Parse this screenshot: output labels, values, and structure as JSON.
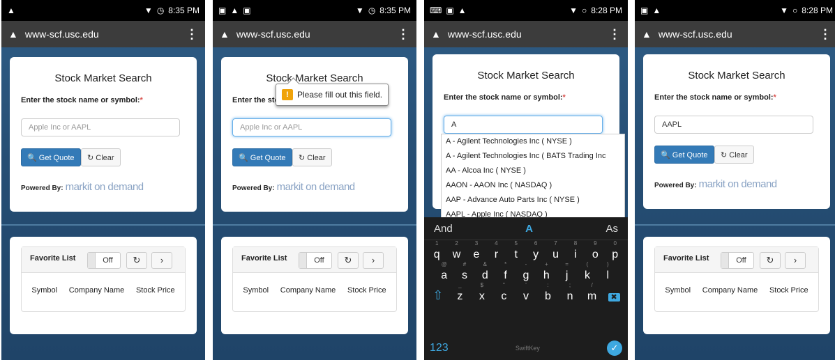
{
  "phones": [
    {
      "status_time": "8:35 PM",
      "url": "www-scf.usc.edu",
      "title": "Stock Market Search",
      "label": "Enter the stock name or symbol:",
      "required_mark": "*",
      "input_text": "Apple Inc or AAPL",
      "get_quote": "Get Quote",
      "clear": "Clear",
      "powered_by": "Powered By:",
      "logo": "markit on demand",
      "fav_title": "Favorite List",
      "toggle": "Off",
      "col_symbol": "Symbol",
      "col_company": "Company Name",
      "col_price": "Stock Price"
    },
    {
      "status_time": "8:35 PM",
      "url": "www-scf.usc.edu",
      "title": "Stock Market Search",
      "label": "Enter the stock name or symbol:",
      "required_mark": "*",
      "input_text": "Apple Inc or AAPL",
      "get_quote": "Get Quote",
      "clear": "Clear",
      "powered_by": "Powered By:",
      "logo": "markit on demand",
      "tooltip": "Please fill out this field.",
      "fav_title": "Favorite List",
      "toggle": "Off",
      "col_symbol": "Symbol",
      "col_company": "Company Name",
      "col_price": "Stock Price"
    },
    {
      "status_time": "8:28 PM",
      "url": "www-scf.usc.edu",
      "title": "Stock Market Search",
      "label": "Enter the stock name or symbol:",
      "required_mark": "*",
      "input_text": "A",
      "autocomplete": [
        "A - Agilent Technologies Inc ( NYSE )",
        "A - Agilent Technologies Inc ( BATS Trading Inc",
        "AA - Alcoa Inc ( NYSE )",
        "AAON - AAON Inc ( NASDAQ )",
        "AAP - Advance Auto Parts Inc ( NYSE )",
        "AAPL - Apple Inc ( NASDAQ )"
      ],
      "keyboard": {
        "suggestions": [
          "And",
          "A",
          "As"
        ],
        "row1": [
          "q",
          "w",
          "e",
          "r",
          "t",
          "y",
          "u",
          "i",
          "o",
          "p"
        ],
        "row1_sup": [
          "1",
          "2",
          "3",
          "4",
          "5",
          "6",
          "7",
          "8",
          "9",
          "0"
        ],
        "row2": [
          "a",
          "s",
          "d",
          "f",
          "g",
          "h",
          "j",
          "k",
          "l"
        ],
        "row2_sup": [
          "@",
          "#",
          "&",
          "*",
          "-",
          "+",
          "=",
          "(",
          ")"
        ],
        "row3": [
          "z",
          "x",
          "c",
          "v",
          "b",
          "n",
          "m"
        ],
        "row3_sup": [
          "_",
          "$",
          "\"",
          "'",
          ":",
          ";",
          "/"
        ],
        "num_key": "123",
        "brand": "SwiftKey"
      }
    },
    {
      "status_time": "8:28 PM",
      "url": "www-scf.usc.edu",
      "title": "Stock Market Search",
      "label": "Enter the stock name or symbol:",
      "required_mark": "*",
      "input_text": "AAPL",
      "get_quote": "Get Quote",
      "clear": "Clear",
      "powered_by": "Powered By:",
      "logo": "markit on demand",
      "fav_title": "Favorite List",
      "toggle": "Off",
      "col_symbol": "Symbol",
      "col_company": "Company Name",
      "col_price": "Stock Price"
    }
  ]
}
